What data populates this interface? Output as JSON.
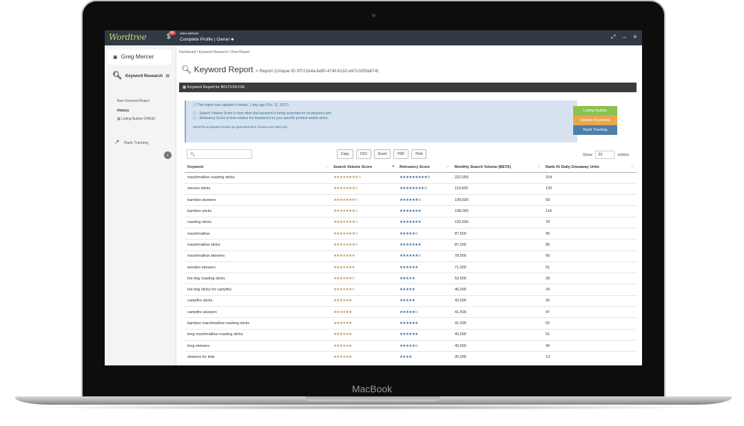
{
  "device_label": "MacBook",
  "topbar": {
    "logo": "Wordtree",
    "notification_count": "40",
    "user_role": "GREG MERCER",
    "profile_text": "Complete Profile | Owner ♣",
    "icons": [
      "expand-icon",
      "logout-icon",
      "menu-icon"
    ]
  },
  "sidebar": {
    "user_name": "Greg Mercer",
    "keyword_research": "Keyword Research",
    "new_report": "New Keyword Report",
    "history": "History",
    "listing_builder": "Listing Builder (FREE)",
    "rank_tracking": "Rank Tracking"
  },
  "breadcrumb": "Dashboard / Keyword Research / View Report",
  "page_title": "Keyword Report",
  "page_subtitle": "> Report (Unique ID 0f721b4a-bdf0-474f-8132-e97c33f3a874)",
  "panel_title": "Keyword Report for B017VXKVXE",
  "info": {
    "line1": "ⓘ This report was updated 4 weeks, 1 day ago (Oct. 11, 2017)",
    "line2": "ⓘ - Search Volume Score is how often that keyword is being searched for on Amazon.com.",
    "line3": "ⓘ - Relevancy Score is how relative the keyword is to your specific product and/or niche.",
    "footnote": "WordTree.io keyword results are generated from Amazon.com data only."
  },
  "action_buttons": [
    {
      "label": "Listing Builder",
      "color": "#8cc152"
    },
    {
      "label": "Update Keywords",
      "color": "#e8a84a"
    },
    {
      "label": "Rank Tracking",
      "color": "#4d7fa8"
    }
  ],
  "search": {
    "icon": "search-icon",
    "placeholder": ""
  },
  "export_buttons": [
    "Copy",
    "CSV",
    "Excel",
    "PDF",
    "Print"
  ],
  "show_label": "Show",
  "show_value": "25",
  "entries_label": "entries",
  "table": {
    "headers": [
      "Keyword",
      "Search Volume Score",
      "Relevancy Score",
      "Monthly Search Volume (BETA)",
      "Rank #1 Daily Giveaway Units"
    ],
    "rows": [
      {
        "keyword": "marshmallow roasting sticks",
        "svs": "★★★★★★★★½",
        "rel": "★★★★★★★★★½",
        "msv": "222,000",
        "units": "154"
      },
      {
        "keyword": "smores sticks",
        "svs": "★★★★★★★½",
        "rel": "★★★★★★★★½",
        "msv": "119,500",
        "units": "120"
      },
      {
        "keyword": "bamboo skewers",
        "svs": "★★★★★★★½",
        "rel": "★★★★★★½",
        "msv": "108,500",
        "units": "59"
      },
      {
        "keyword": "bamboo sticks",
        "svs": "★★★★★★★½",
        "rel": "★★★★★★★",
        "msv": "108,000",
        "units": "114"
      },
      {
        "keyword": "roasting sticks",
        "svs": "★★★★★★★½",
        "rel": "★★★★★★★",
        "msv": "102,500",
        "units": "78"
      },
      {
        "keyword": "marshmallow",
        "svs": "★★★★★★★½",
        "rel": "★★★★★½",
        "msv": "87,500",
        "units": "45"
      },
      {
        "keyword": "marshmallow sticks",
        "svs": "★★★★★★★½",
        "rel": "★★★★★★★",
        "msv": "87,000",
        "units": "80"
      },
      {
        "keyword": "marshmallow skewers",
        "svs": "★★★★★★★",
        "rel": "★★★★★★½",
        "msv": "78,500",
        "units": "60"
      },
      {
        "keyword": "wooden skewers",
        "svs": "★★★★★★★",
        "rel": "★★★★★★",
        "msv": "71,000",
        "units": "51"
      },
      {
        "keyword": "hot dog roasting sticks",
        "svs": "★★★★★★½",
        "rel": "★★★★★",
        "msv": "53,500",
        "units": "39"
      },
      {
        "keyword": "hot dog sticks for campfire",
        "svs": "★★★★★★½",
        "rel": "★★★★★",
        "msv": "46,000",
        "units": "34"
      },
      {
        "keyword": "campfire sticks",
        "svs": "★★★★★★",
        "rel": "★★★★★",
        "msv": "42,000",
        "units": "36"
      },
      {
        "keyword": "campfire skewers",
        "svs": "★★★★★★",
        "rel": "★★★★★½",
        "msv": "41,500",
        "units": "47"
      },
      {
        "keyword": "bamboo marshmallow roasting sticks",
        "svs": "★★★★★★",
        "rel": "★★★★★★",
        "msv": "41,000",
        "units": "52"
      },
      {
        "keyword": "long marshmallow roasting sticks",
        "svs": "★★★★★★",
        "rel": "★★★★★★",
        "msv": "40,000",
        "units": "51"
      },
      {
        "keyword": "long skewers",
        "svs": "★★★★★★",
        "rel": "★★★★★½",
        "msv": "40,000",
        "units": "40"
      },
      {
        "keyword": "skewers for kids",
        "svs": "★★★★★★",
        "rel": "★★★★",
        "msv": "35,000",
        "units": "13"
      }
    ]
  }
}
